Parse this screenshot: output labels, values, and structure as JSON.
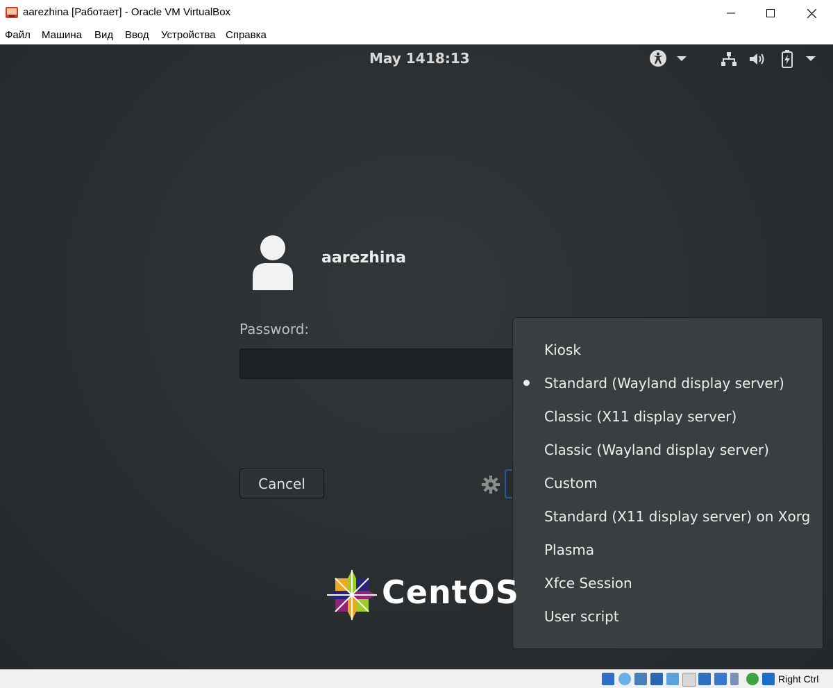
{
  "window": {
    "title": "aarezhina [Работает] - Oracle VM VirtualBox",
    "controls": {
      "minimize": "minimize",
      "maximize": "maximize",
      "close": "close"
    }
  },
  "menu": [
    "Файл",
    "Машина",
    "Вид",
    "Ввод",
    "Устройства",
    "Справка"
  ],
  "gnome_top_bar": {
    "date": "May 14",
    "time": "18:13",
    "icons": [
      "accessibility-icon",
      "chevron-down-icon",
      "network-icon",
      "volume-icon",
      "battery-icon",
      "chevron-down-icon"
    ]
  },
  "login": {
    "username": "aarezhina",
    "password_label": "Password:",
    "password_value": "",
    "cancel_label": "Cancel"
  },
  "session_menu": {
    "selected_index": 1,
    "items": [
      "Kiosk",
      "Standard (Wayland display server)",
      "Classic (X11 display server)",
      "Classic (Wayland display server)",
      "Custom",
      "Standard (X11 display server) on Xorg",
      "Plasma",
      "Xfce Session",
      "User script"
    ]
  },
  "branding": {
    "logo_text": "CentOS"
  },
  "statusbar": {
    "icons": [
      "hard-disk-icon",
      "optical-drive-icon",
      "audio-icon",
      "network-adapter-icon",
      "usb-icon",
      "shared-folder-icon",
      "display-icon",
      "video-capture-icon",
      "cpu-icon",
      "mouse-integration-icon",
      "keyboard-icon"
    ],
    "host_key": "Right Ctrl"
  }
}
